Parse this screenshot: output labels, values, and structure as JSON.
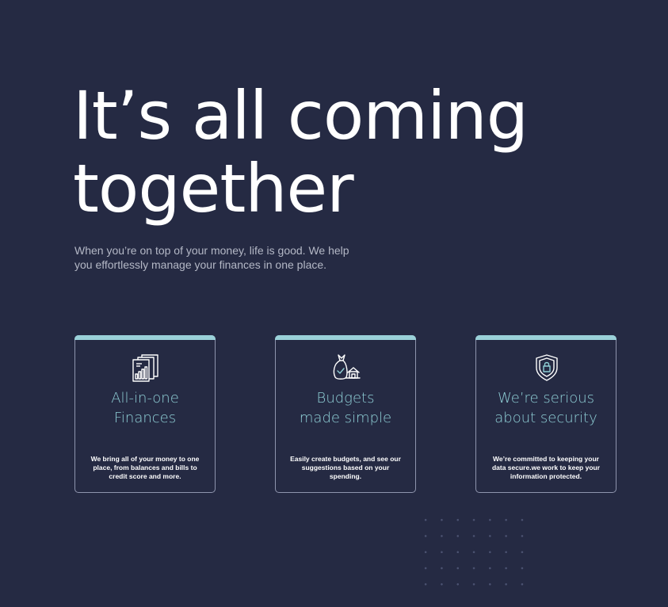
{
  "hero": {
    "title": "It’s all coming together",
    "subtitle": "When you’re on top of your money, life is good. We help you effortlessly manage your finances in one place."
  },
  "cards": [
    {
      "icon": "documents-chart-icon",
      "title": "All-in-one\nFinances",
      "description": "We bring all of your money to one place, from balances and bills to credit score and more."
    },
    {
      "icon": "money-bag-house-icon",
      "title": "Budgets\nmade simple",
      "description": "Easily create budgets, and see our suggestions based on your spending."
    },
    {
      "icon": "security-shield-lock-icon",
      "title": "We’re serious\nabout security",
      "description": "We’re committed to keeping your data secure.we work to keep your information protected."
    }
  ],
  "colors": {
    "background": "#252a43",
    "accent": "#9ad1d9",
    "card_title": "#8fcfd6",
    "subtitle": "#b4b8c6"
  }
}
